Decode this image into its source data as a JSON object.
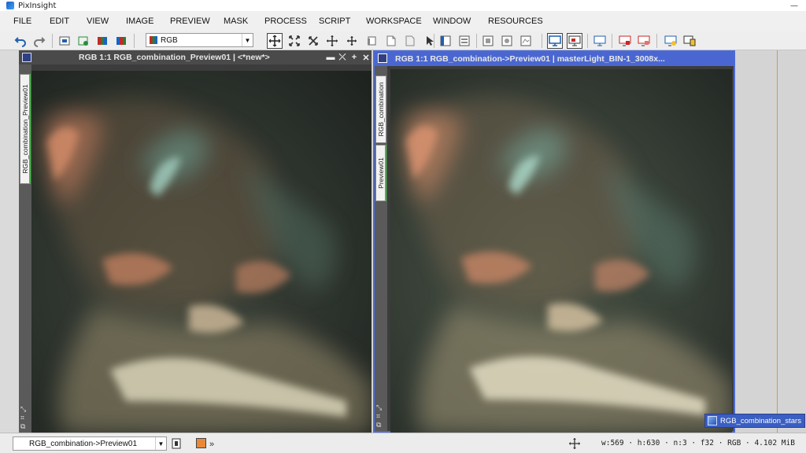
{
  "window": {
    "title": "PixInsight",
    "minimize": "—",
    "maximize": "□",
    "close": "✕"
  },
  "menu": [
    "FILE",
    "EDIT",
    "VIEW",
    "IMAGE",
    "PREVIEW",
    "MASK",
    "PROCESS",
    "SCRIPT",
    "WORKSPACE",
    "WINDOW",
    "RESOURCES"
  ],
  "toolbar": {
    "channel_combo": "RGB",
    "combo_arrow": "▼"
  },
  "views": {
    "left": {
      "title": "RGB 1:1 RGB_combination_Preview01 | <*new*>",
      "vtab": "RGB_combination_Preview01"
    },
    "right": {
      "title": "RGB 1:1 RGB_combination->Preview01 | masterLight_BIN-1_3008x...",
      "vtabs": [
        "RGB_combination",
        "Preview01"
      ]
    }
  },
  "icons_panel": {
    "label": "RGB_combination_stars"
  },
  "statusbar": {
    "view_combo": "RGB_combination->Preview01",
    "combo_arrow": "▼",
    "more": "»",
    "info": "w:569 · h:630 · n:3 · f32 · RGB · 4.102 MiB"
  },
  "colors": {
    "accent": "#3a5ec2",
    "nebula_red": "#c47a5a",
    "nebula_teal": "#5f8f86",
    "active_tab": "#3fbf3f"
  }
}
